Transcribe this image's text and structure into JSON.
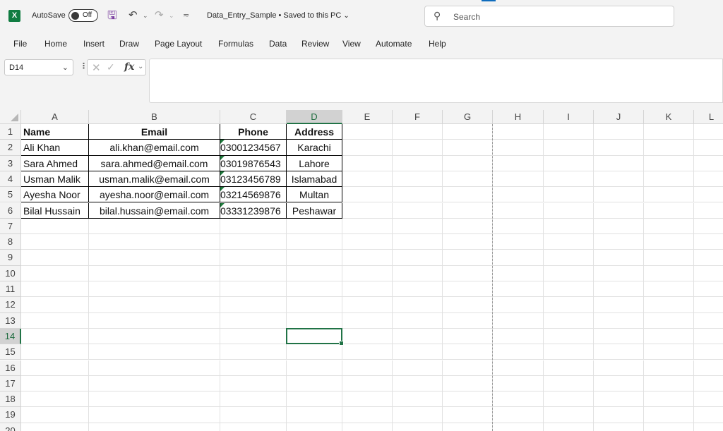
{
  "titlebar": {
    "logo": "X",
    "autosave_label": "AutoSave",
    "autosave_state": "Off",
    "doc_title": "Data_Entry_Sample • Saved to this PC",
    "search_placeholder": "Search"
  },
  "menu": [
    "File",
    "Home",
    "Insert",
    "Draw",
    "Page Layout",
    "Formulas",
    "Data",
    "Review",
    "View",
    "Automate",
    "Help"
  ],
  "formula_bar": {
    "name_box": "D14",
    "fx_label": "fx",
    "formula_value": ""
  },
  "grid": {
    "columns": [
      "A",
      "B",
      "C",
      "D",
      "E",
      "F",
      "G",
      "H",
      "I",
      "J",
      "K",
      "L"
    ],
    "rows": [
      "1",
      "2",
      "3",
      "4",
      "5",
      "6",
      "7",
      "8",
      "9",
      "10",
      "11",
      "12",
      "13",
      "14",
      "15",
      "16",
      "17",
      "18",
      "19",
      "20"
    ],
    "selected_column": "D",
    "selected_row": "14",
    "active_cell": "D14",
    "headers": [
      "Name",
      "Email",
      "Phone",
      "Address"
    ],
    "records": [
      [
        "Ali Khan",
        "ali.khan@email.com",
        "03001234567",
        "Karachi"
      ],
      [
        "Sara Ahmed",
        "sara.ahmed@email.com",
        "03019876543",
        "Lahore"
      ],
      [
        "Usman Malik",
        "usman.malik@email.com",
        "03123456789",
        "Islamabad"
      ],
      [
        "Ayesha Noor",
        "ayesha.noor@email.com",
        "03214569876",
        "Multan"
      ],
      [
        "Bilal Hussain",
        "bilal.hussain@email.com",
        "03331239876",
        "Peshawar"
      ]
    ]
  },
  "colors": {
    "excel_green": "#217346",
    "save_purple": "#7b3fa0",
    "error_flag": "#1e7a3c"
  }
}
